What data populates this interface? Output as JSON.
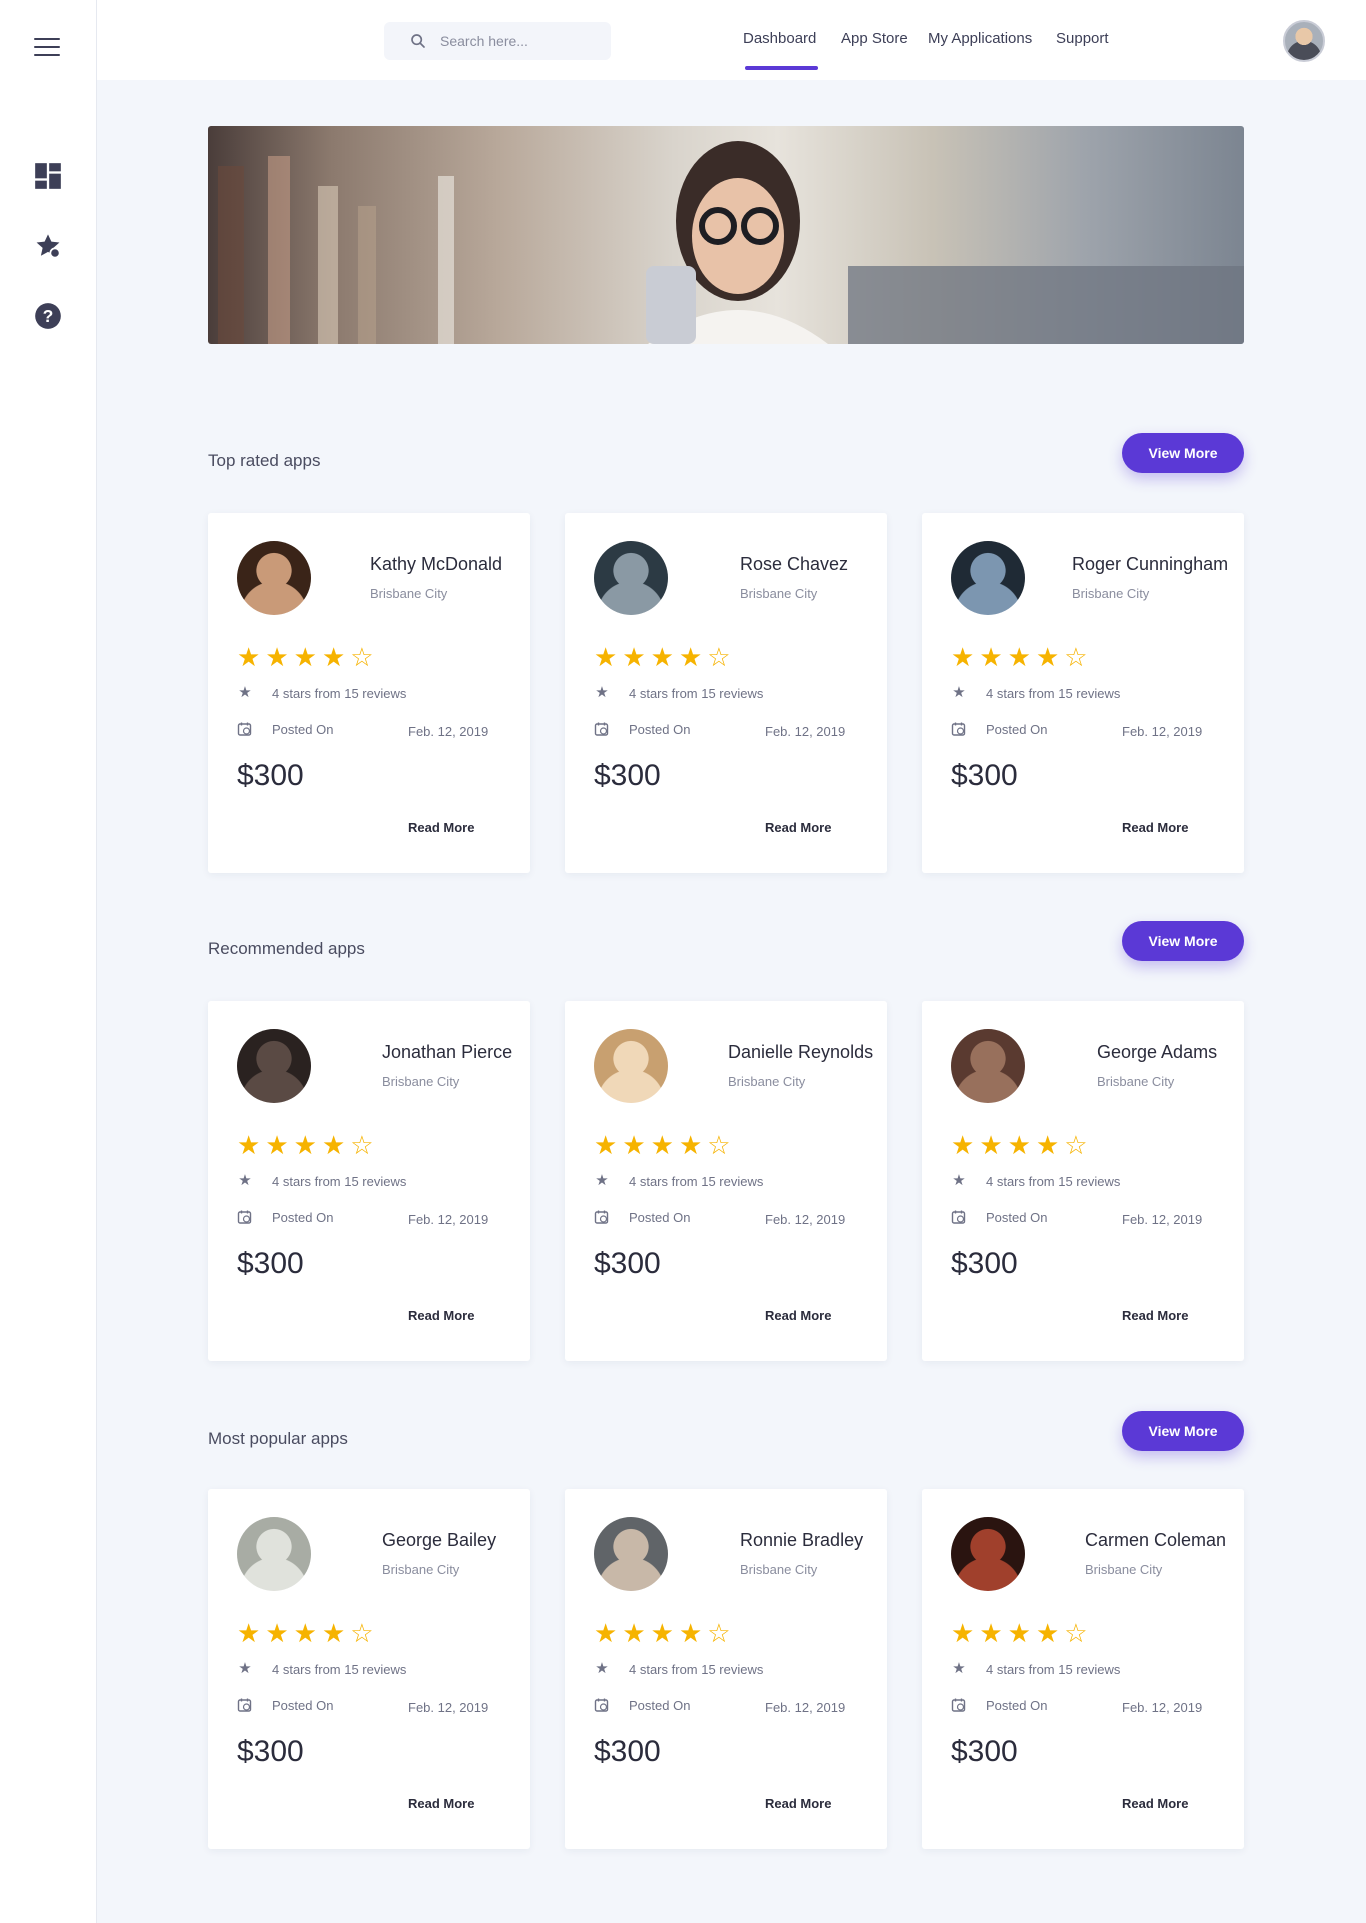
{
  "search": {
    "placeholder": "Search here..."
  },
  "nav": {
    "dashboard": "Dashboard",
    "app_store": "App Store",
    "my_applications": "My Applications",
    "support": "Support"
  },
  "colors": {
    "accent": "#5b39d6",
    "star": "#f6b300"
  },
  "sections": [
    {
      "title": "Top rated apps",
      "button": "View More",
      "cards": [
        {
          "name": "Kathy McDonald",
          "city": "Brisbane City",
          "reviews": "4 stars from 15 reviews",
          "posted_label": "Posted On",
          "date": "Feb. 12, 2019",
          "price": "$300",
          "read_more": "Read More",
          "rating": 4
        },
        {
          "name": "Rose Chavez",
          "city": "Brisbane City",
          "reviews": "4 stars from 15 reviews",
          "posted_label": "Posted On",
          "date": "Feb. 12, 2019",
          "price": "$300",
          "read_more": "Read More",
          "rating": 4
        },
        {
          "name": "Roger Cunningham",
          "city": "Brisbane City",
          "reviews": "4 stars from 15 reviews",
          "posted_label": "Posted On",
          "date": "Feb. 12, 2019",
          "price": "$300",
          "read_more": "Read More",
          "rating": 4
        }
      ]
    },
    {
      "title": "Recommended apps",
      "button": "View More",
      "cards": [
        {
          "name": "Jonathan Pierce",
          "city": "Brisbane City",
          "reviews": "4 stars from 15 reviews",
          "posted_label": "Posted On",
          "date": "Feb. 12, 2019",
          "price": "$300",
          "read_more": "Read More",
          "rating": 4
        },
        {
          "name": "Danielle Reynolds",
          "city": "Brisbane City",
          "reviews": "4 stars from 15 reviews",
          "posted_label": "Posted On",
          "date": "Feb. 12, 2019",
          "price": "$300",
          "read_more": "Read More",
          "rating": 4
        },
        {
          "name": "George Adams",
          "city": "Brisbane City",
          "reviews": "4 stars from 15 reviews",
          "posted_label": "Posted On",
          "date": "Feb. 12, 2019",
          "price": "$300",
          "read_more": "Read More",
          "rating": 4
        }
      ]
    },
    {
      "title": "Most popular apps",
      "button": "View More",
      "cards": [
        {
          "name": "George Bailey",
          "city": "Brisbane City",
          "reviews": "4 stars from 15 reviews",
          "posted_label": "Posted On",
          "date": "Feb. 12, 2019",
          "price": "$300",
          "read_more": "Read More",
          "rating": 4
        },
        {
          "name": "Ronnie Bradley",
          "city": "Brisbane City",
          "reviews": "4 stars from 15 reviews",
          "posted_label": "Posted On",
          "date": "Feb. 12, 2019",
          "price": "$300",
          "read_more": "Read More",
          "rating": 4
        },
        {
          "name": "Carmen Coleman",
          "city": "Brisbane City",
          "reviews": "4 stars from 15 reviews",
          "posted_label": "Posted On",
          "date": "Feb. 12, 2019",
          "price": "$300",
          "read_more": "Read More",
          "rating": 4
        }
      ]
    }
  ]
}
